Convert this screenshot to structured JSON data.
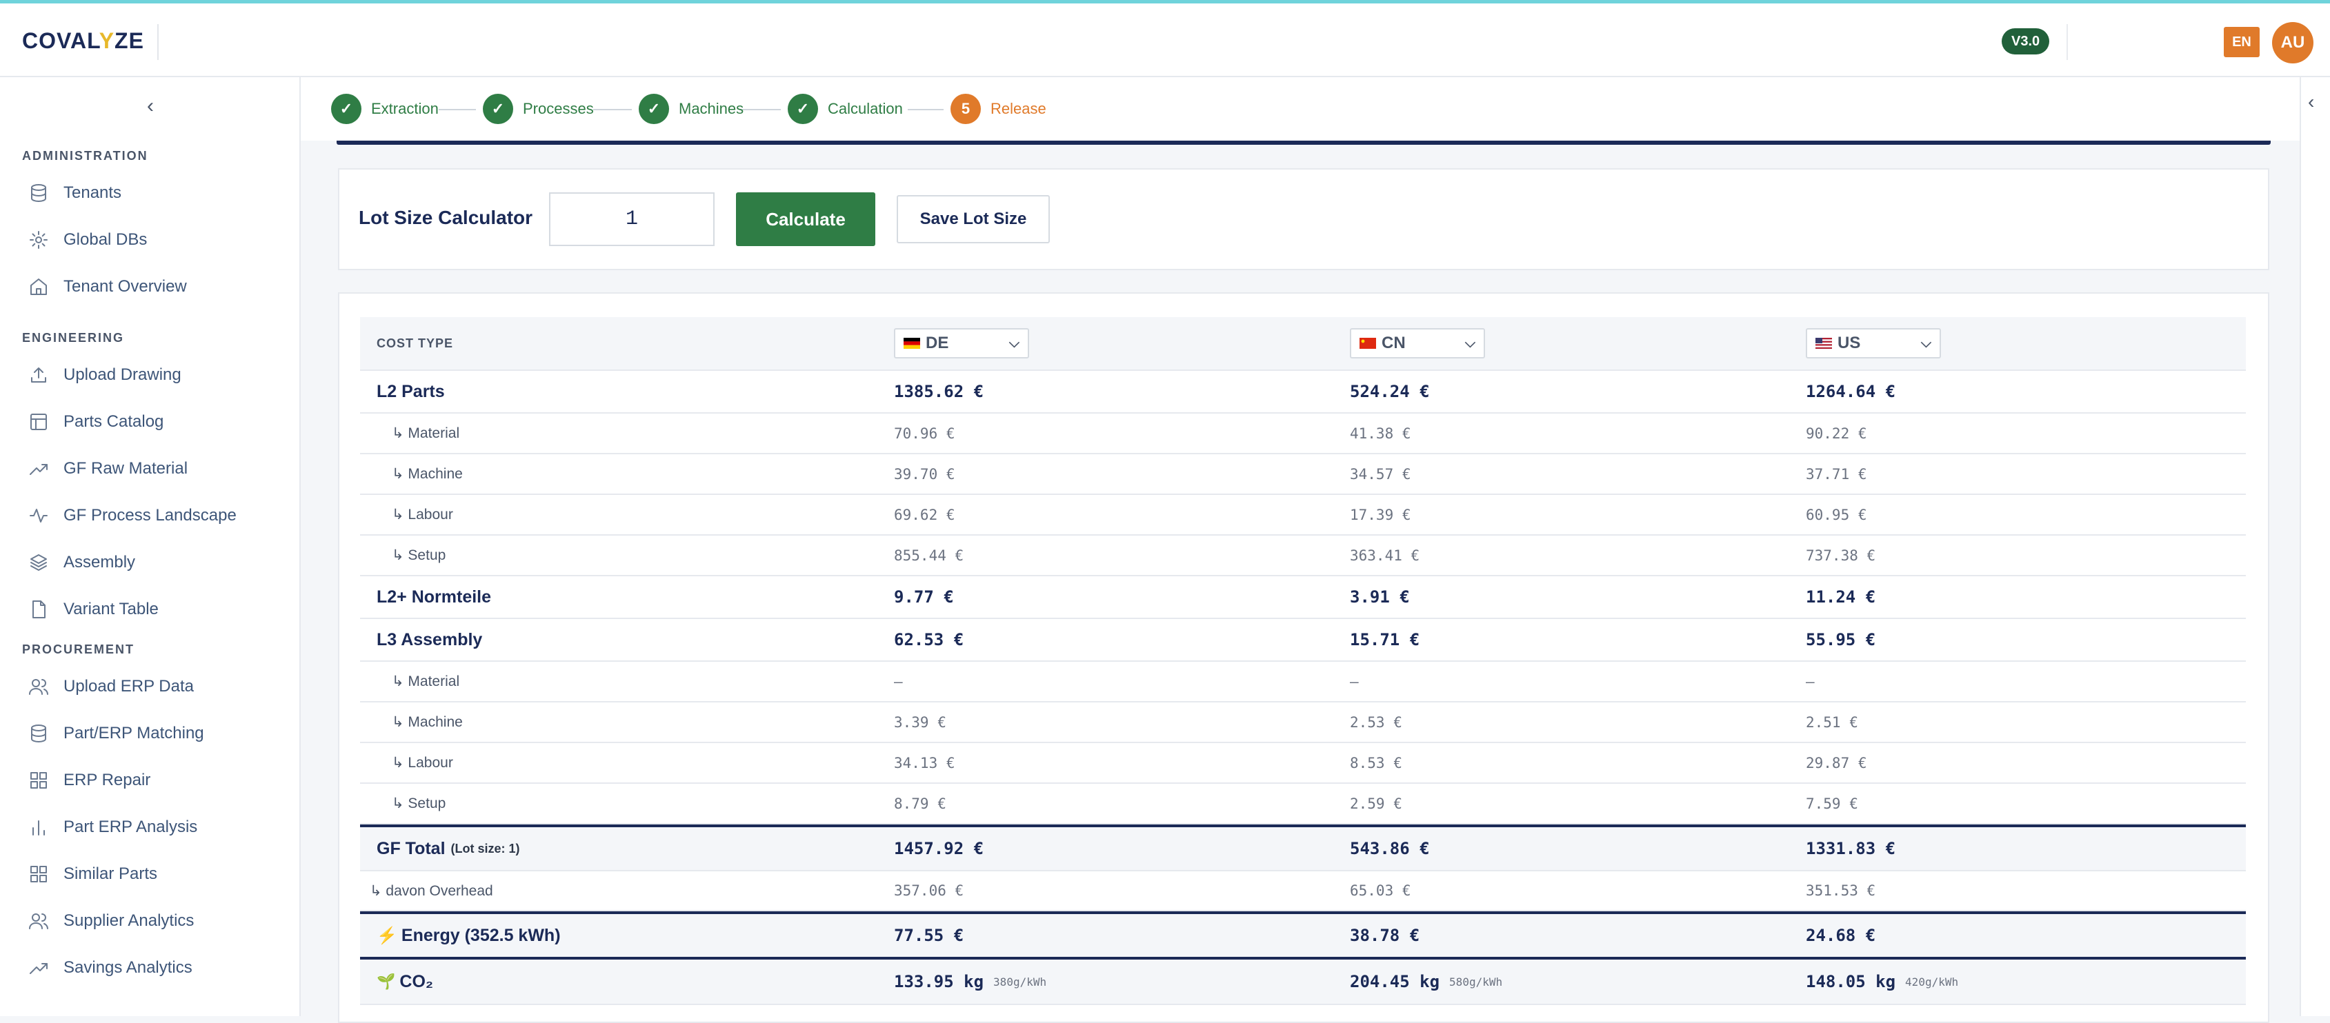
{
  "app": {
    "logo_pre": "COVAL",
    "logo_y": "Y",
    "logo_post": "ZE",
    "version": "V3.0",
    "language": "EN",
    "user_initials": "AU"
  },
  "sidebar": {
    "collapse_icon": "chevron-left-icon",
    "sections": [
      {
        "title": "ADMINISTRATION",
        "items": [
          {
            "label": "Tenants",
            "icon": "database-icon"
          },
          {
            "label": "Global DBs",
            "icon": "gear-icon"
          },
          {
            "label": "Tenant Overview",
            "icon": "home-icon"
          }
        ]
      },
      {
        "title": "ENGINEERING",
        "items": [
          {
            "label": "Upload Drawing",
            "icon": "upload-icon"
          },
          {
            "label": "Parts Catalog",
            "icon": "table-icon"
          },
          {
            "label": "GF Raw Material",
            "icon": "trending-up-icon"
          },
          {
            "label": "GF Process Landscape",
            "icon": "activity-icon"
          },
          {
            "label": "Assembly",
            "icon": "layers-icon"
          },
          {
            "label": "Variant Table",
            "icon": "file-icon"
          }
        ]
      },
      {
        "title": "PROCUREMENT",
        "items": [
          {
            "label": "Upload ERP Data",
            "icon": "users-icon"
          },
          {
            "label": "Part/ERP Matching",
            "icon": "database-icon"
          },
          {
            "label": "ERP Repair",
            "icon": "grid-icon"
          },
          {
            "label": "Part ERP Analysis",
            "icon": "bar-chart-icon"
          },
          {
            "label": "Similar Parts",
            "icon": "grid-icon"
          },
          {
            "label": "Supplier Analytics",
            "icon": "users-icon"
          },
          {
            "label": "Savings Analytics",
            "icon": "trending-up-icon"
          }
        ]
      }
    ]
  },
  "stepper": {
    "steps": [
      {
        "label": "Extraction",
        "state": "done"
      },
      {
        "label": "Processes",
        "state": "done"
      },
      {
        "label": "Machines",
        "state": "done"
      },
      {
        "label": "Calculation",
        "state": "done"
      },
      {
        "label": "Release",
        "state": "current",
        "number": "5"
      }
    ]
  },
  "lot": {
    "title": "Lot Size Calculator",
    "value": "1",
    "calculate_label": "Calculate",
    "save_label": "Save Lot Size"
  },
  "table": {
    "header": {
      "cost_type": "COST TYPE",
      "countries": [
        {
          "code": "DE",
          "flag_colors": [
            "#000000",
            "#dd0000",
            "#ffce00"
          ]
        },
        {
          "code": "CN",
          "flag_colors": [
            "#de2910",
            "#ffde00"
          ]
        },
        {
          "code": "US",
          "flag_colors": [
            "#b22234",
            "#ffffff",
            "#3c3b6e"
          ]
        }
      ]
    },
    "rows": [
      {
        "label": "L2 Parts",
        "kind": "main",
        "values": [
          "1385.62 €",
          "524.24 €",
          "1264.64 €"
        ]
      },
      {
        "label": "↳ Material",
        "kind": "sub",
        "values": [
          "70.96 €",
          "41.38 €",
          "90.22 €"
        ]
      },
      {
        "label": "↳ Machine",
        "kind": "sub",
        "values": [
          "39.70 €",
          "34.57 €",
          "37.71 €"
        ]
      },
      {
        "label": "↳ Labour",
        "kind": "sub",
        "values": [
          "69.62 €",
          "17.39 €",
          "60.95 €"
        ]
      },
      {
        "label": "↳ Setup",
        "kind": "sub",
        "values": [
          "855.44 €",
          "363.41 €",
          "737.38 €"
        ]
      },
      {
        "label": "L2+ Normteile",
        "kind": "main",
        "values": [
          "9.77 €",
          "3.91 €",
          "11.24 €"
        ]
      },
      {
        "label": "L3 Assembly",
        "kind": "main",
        "values": [
          "62.53 €",
          "15.71 €",
          "55.95 €"
        ]
      },
      {
        "label": "↳ Material",
        "kind": "sub",
        "values": [
          "–",
          "–",
          "–"
        ]
      },
      {
        "label": "↳ Machine",
        "kind": "sub",
        "values": [
          "3.39 €",
          "2.53 €",
          "2.51 €"
        ]
      },
      {
        "label": "↳ Labour",
        "kind": "sub",
        "values": [
          "34.13 €",
          "8.53 €",
          "29.87 €"
        ]
      },
      {
        "label": "↳ Setup",
        "kind": "sub",
        "values": [
          "8.79 €",
          "2.59 €",
          "7.59 €"
        ]
      }
    ],
    "total": {
      "label": "GF Total",
      "note": "(Lot size: 1)",
      "values": [
        "1457.92 €",
        "543.86 €",
        "1331.83 €"
      ]
    },
    "overhead": {
      "label": "↳ davon Overhead",
      "values": [
        "357.06 €",
        "65.03 €",
        "351.53 €"
      ]
    },
    "energy": {
      "icon": "⚡",
      "label": "Energy (352.5 kWh)",
      "values": [
        "77.55 €",
        "38.78 €",
        "24.68 €"
      ]
    },
    "co2": {
      "icon": "🌱",
      "label": "CO₂",
      "values": [
        "133.95 kg",
        "204.45 kg",
        "148.05 kg"
      ],
      "factors": [
        "380g/kWh",
        "580g/kWh",
        "420g/kWh"
      ]
    }
  }
}
